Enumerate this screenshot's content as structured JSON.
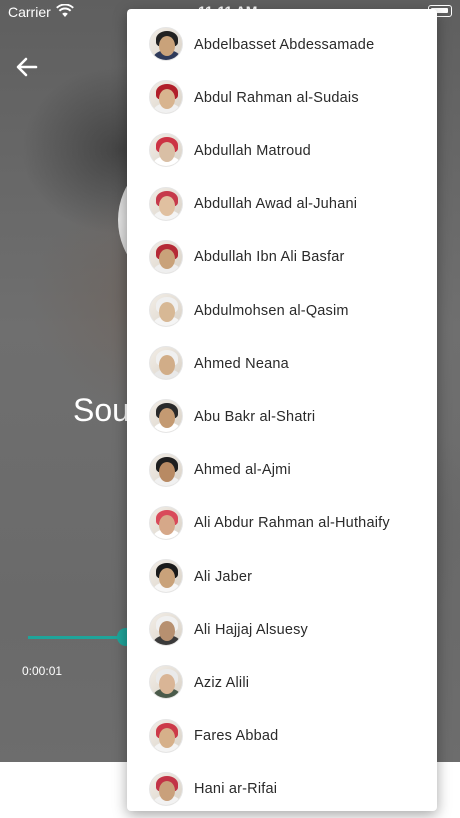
{
  "status_bar": {
    "carrier": "Carrier",
    "time": "11:11 AM"
  },
  "player": {
    "title": "Sou",
    "elapsed": "0:00:01",
    "accent_color": "#1fa49a"
  },
  "reciters": [
    {
      "name": "Abdelbasset Abdessamade",
      "avatar": {
        "skin": "#c9a27a",
        "cloth": "#2e3a5a",
        "hair": "#222222"
      }
    },
    {
      "name": "Abdul Rahman al-Sudais",
      "avatar": {
        "skin": "#d8b48f",
        "cloth": "#f1f1f1",
        "hair": "#b11f2a"
      }
    },
    {
      "name": "Abdullah Matroud",
      "avatar": {
        "skin": "#d9bfa5",
        "cloth": "#ffffff",
        "hair": "#cc3344"
      }
    },
    {
      "name": "Abdullah Awad al-Juhani",
      "avatar": {
        "skin": "#e0c0a0",
        "cloth": "#f4f4f4",
        "hair": "#c63a4b"
      }
    },
    {
      "name": "Abdullah Ibn Ali Basfar",
      "avatar": {
        "skin": "#c9a27a",
        "cloth": "#efefef",
        "hair": "#b52a36"
      }
    },
    {
      "name": "Abdulmohsen al-Qasim",
      "avatar": {
        "skin": "#d7b895",
        "cloth": "#f5f5f5",
        "hair": "#efefef"
      }
    },
    {
      "name": "Ahmed Neana",
      "avatar": {
        "skin": "#d1ad88",
        "cloth": "#e9e9e9",
        "hair": "#f0f0f0"
      }
    },
    {
      "name": "Abu Bakr al-Shatri",
      "avatar": {
        "skin": "#c49a72",
        "cloth": "#ffffff",
        "hair": "#2a2a2a"
      }
    },
    {
      "name": "Ahmed al-Ajmi",
      "avatar": {
        "skin": "#b88a63",
        "cloth": "#f1f1f1",
        "hair": "#1e1e1e"
      }
    },
    {
      "name": "Ali Abdur Rahman al-Huthaify",
      "avatar": {
        "skin": "#d6a889",
        "cloth": "#ffffff",
        "hair": "#d94a5a"
      }
    },
    {
      "name": "Ali Jaber",
      "avatar": {
        "skin": "#c9a27a",
        "cloth": "#f7f7f7",
        "hair": "#1a1a1a"
      }
    },
    {
      "name": "Ali Hajjaj Alsuesy",
      "avatar": {
        "skin": "#b79070",
        "cloth": "#3a3a3a",
        "hair": "#f0f0f0"
      }
    },
    {
      "name": "Aziz Alili",
      "avatar": {
        "skin": "#d9b596",
        "cloth": "#4a5a4a",
        "hair": "#eaeaea"
      }
    },
    {
      "name": "Fares Abbad",
      "avatar": {
        "skin": "#d6b08a",
        "cloth": "#f4f4f4",
        "hair": "#cc3a48"
      }
    },
    {
      "name": "Hani ar-Rifai",
      "avatar": {
        "skin": "#c9a07b",
        "cloth": "#f2f2f2",
        "hair": "#c23346"
      }
    }
  ]
}
